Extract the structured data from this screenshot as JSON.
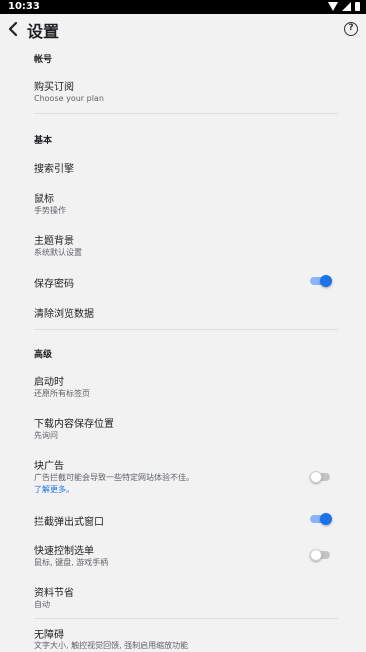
{
  "status_bar": {
    "time": "10:33"
  },
  "header": {
    "title": "设置",
    "help_label": "?"
  },
  "sections": {
    "account": {
      "label": "帐号"
    },
    "basic": {
      "label": "基本"
    },
    "advanced": {
      "label": "高级"
    }
  },
  "items": {
    "subscribe": {
      "title": "购买订阅",
      "subtitle": "Choose your plan"
    },
    "search_engine": {
      "title": "搜索引擎"
    },
    "mouse": {
      "title": "鼠标",
      "subtitle": "手势操作"
    },
    "theme": {
      "title": "主题背景",
      "subtitle": "系统默认设置"
    },
    "save_password": {
      "title": "保存密码",
      "enabled": true
    },
    "clear_data": {
      "title": "清除浏览数据"
    },
    "startup": {
      "title": "启动时",
      "subtitle": "还原所有标签页"
    },
    "download_location": {
      "title": "下载内容保存位置",
      "subtitle": "先询问"
    },
    "block_ads": {
      "title": "块广告",
      "subtitle": "广告拦截可能会导致一些特定网站体验不佳。",
      "link": "了解更多。",
      "enabled": false
    },
    "block_popups": {
      "title": "拦截弹出式窗口",
      "enabled": true
    },
    "quick_menu": {
      "title": "快速控制选单",
      "subtitle": "鼠标, 键盘, 游戏手柄",
      "enabled": false
    },
    "data_saver": {
      "title": "资料节省",
      "subtitle": "自动"
    },
    "accessibility": {
      "title": "无障碍",
      "subtitle": "文字大小, 触控视觉回馈, 强制启用缩放功能"
    }
  },
  "colors": {
    "accent": "#1a73e8",
    "toggle_on_track": "#8ab4f8",
    "background": "#f2f2f2"
  }
}
